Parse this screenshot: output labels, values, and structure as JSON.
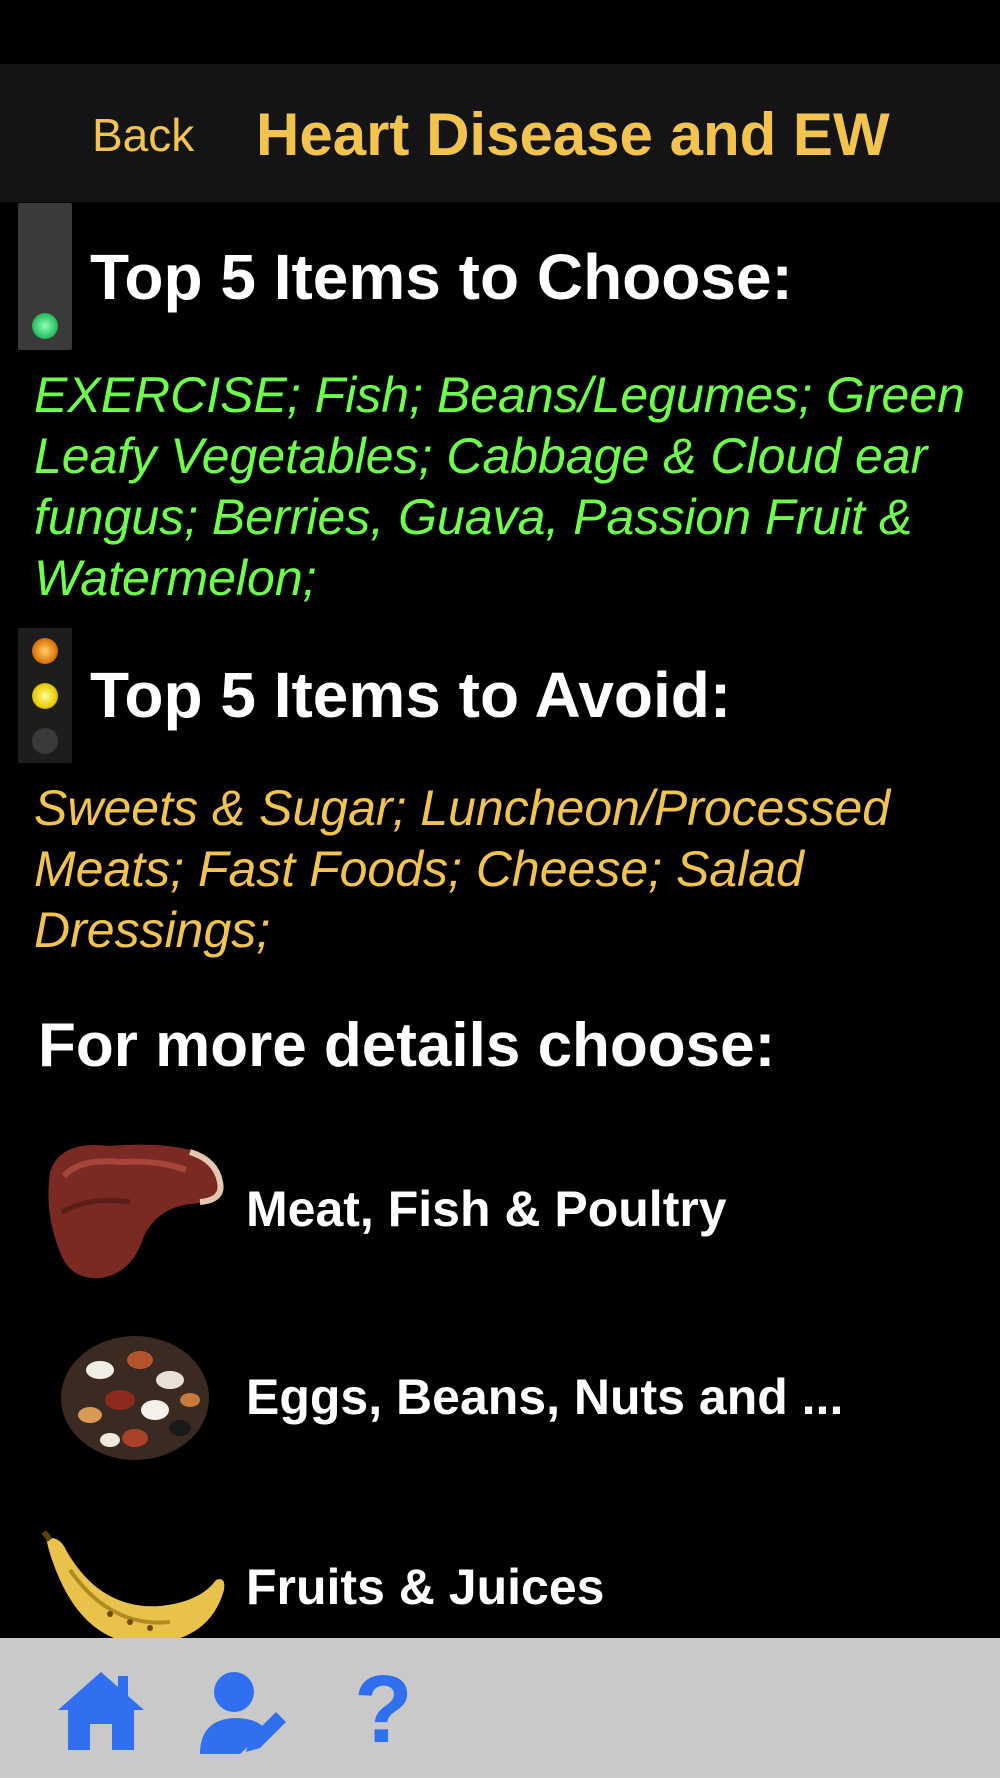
{
  "nav": {
    "back_label": "Back",
    "title": "Heart Disease and EW"
  },
  "choose": {
    "heading": "Top 5 Items to Choose:",
    "items_text": "EXERCISE; Fish; Beans/Legumes; Green Leafy Vegetables; Cabbage & Cloud ear fungus; Berries, Guava, Passion Fruit & Watermelon;"
  },
  "avoid": {
    "heading": "Top 5 Items to Avoid:",
    "items_text": "Sweets & Sugar; Luncheon/Processed Meats; Fast Foods; Cheese; Salad Dressings;"
  },
  "details": {
    "heading": "For more details choose:",
    "categories": [
      {
        "label": "Meat, Fish & Poultry",
        "icon": "steak-icon"
      },
      {
        "label": "Eggs, Beans, Nuts and ...",
        "icon": "beans-icon"
      },
      {
        "label": "Fruits & Juices",
        "icon": "banana-icon"
      }
    ]
  },
  "tab_bar": {
    "icons": [
      "home-icon",
      "edit-profile-icon",
      "help-icon"
    ],
    "help_glyph": "?"
  },
  "colors": {
    "accent": "#f2c44e",
    "choose_text": "#6eff4a",
    "avoid_text": "#f2c44e",
    "tab_icon": "#2f6ff0"
  }
}
